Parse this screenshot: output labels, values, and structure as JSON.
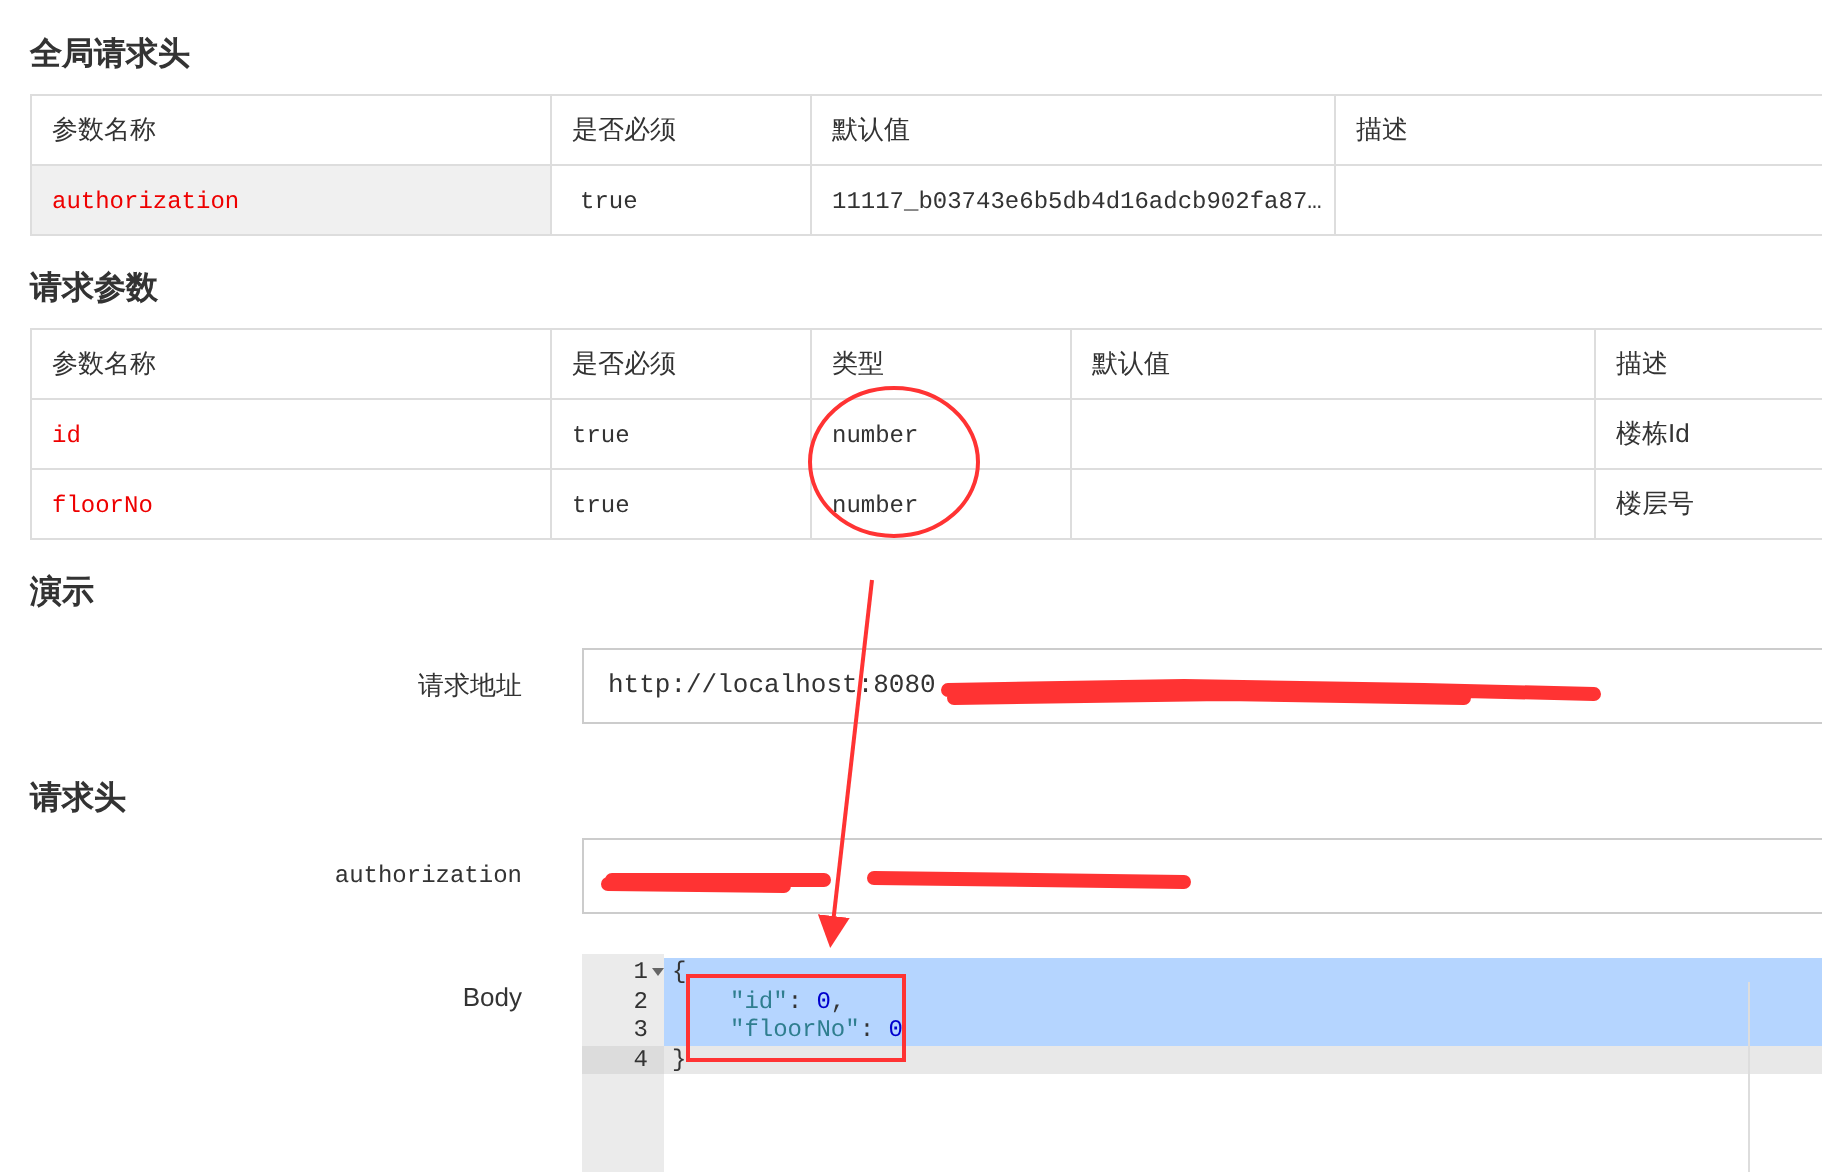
{
  "global_headers": {
    "title": "全局请求头",
    "columns": [
      "参数名称",
      "是否必须",
      "默认值",
      "描述"
    ],
    "rows": [
      {
        "cells": [
          "authorization",
          "true",
          "11117_b03743e6b5db4d16adcb902fa87…"
        ],
        "highlighted": true
      }
    ]
  },
  "request_params": {
    "title": "请求参数",
    "columns": [
      "参数名称",
      "是否必须",
      "类型",
      "默认值",
      "描述"
    ],
    "rows": [
      {
        "cells": [
          "id",
          "true",
          "number",
          "",
          "楼栋Id"
        ],
        "highlighted": false
      },
      {
        "cells": [
          "floorNo",
          "true",
          "number",
          "",
          "楼层号"
        ],
        "highlighted": false
      }
    ]
  },
  "demo": {
    "title": "演示",
    "url_label": "请求地址",
    "url_value": "http://localhost:8080",
    "url_redacted": true
  },
  "headers": {
    "title": "请求头",
    "fields": [
      {
        "label": "authorization",
        "redacted": true
      }
    ]
  },
  "body": {
    "label": "Body",
    "lines": [
      {
        "number": "1",
        "foldable": true,
        "selected": true,
        "active": false,
        "tokens": [
          {
            "kind": "punct",
            "text": "{"
          }
        ]
      },
      {
        "number": "2",
        "foldable": false,
        "selected": true,
        "active": false,
        "tokens": [
          {
            "kind": "key",
            "text": "\"id\""
          },
          {
            "kind": "punct",
            "text": ": "
          },
          {
            "kind": "num",
            "text": "0"
          },
          {
            "kind": "punct",
            "text": ","
          }
        ]
      },
      {
        "number": "3",
        "foldable": false,
        "selected": true,
        "active": false,
        "tokens": [
          {
            "kind": "key",
            "text": "\"floorNo\""
          },
          {
            "kind": "punct",
            "text": ": "
          },
          {
            "kind": "num",
            "text": "0"
          }
        ]
      },
      {
        "number": "4",
        "foldable": false,
        "selected": false,
        "active": true,
        "tokens": [
          {
            "kind": "punct",
            "text": "}"
          }
        ]
      }
    ]
  },
  "annotations": [
    {
      "kind": "circle"
    },
    {
      "kind": "arrow"
    },
    {
      "kind": "rectangle"
    }
  ]
}
